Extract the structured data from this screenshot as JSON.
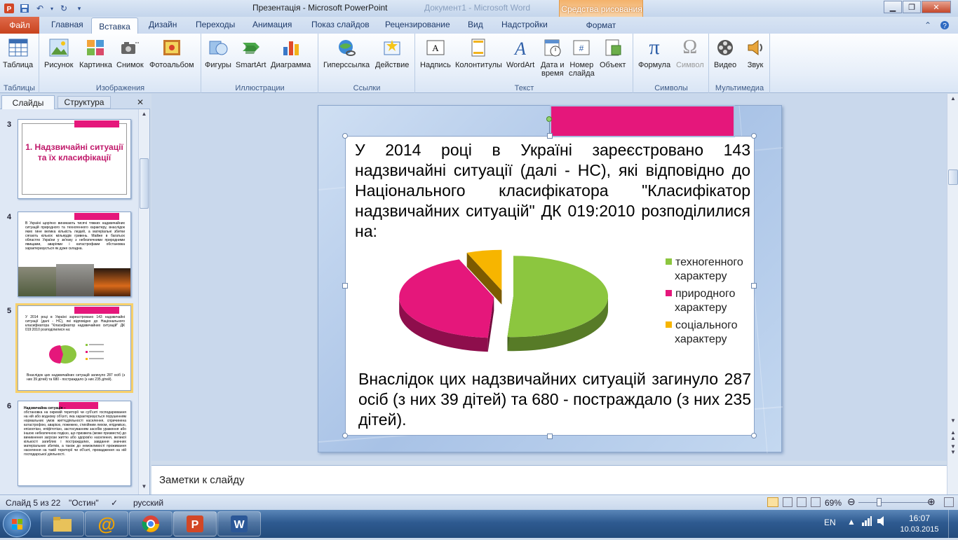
{
  "window": {
    "title": "Презентація - Microsoft PowerPoint",
    "background_window_title": "Документ1 - Microsoft Word",
    "context_tab_group": "Средства рисования"
  },
  "tabs": {
    "file": "Файл",
    "items": [
      "Главная",
      "Вставка",
      "Дизайн",
      "Переходы",
      "Анимация",
      "Показ слайдов",
      "Рецензирование",
      "Вид",
      "Надстройки"
    ],
    "active": "Вставка",
    "format": "Формат"
  },
  "ribbon": {
    "groups": [
      {
        "label": "Таблицы",
        "buttons": [
          {
            "label": "Таблица",
            "icon": "table-icon"
          }
        ]
      },
      {
        "label": "Изображения",
        "buttons": [
          {
            "label": "Рисунок",
            "icon": "picture-icon"
          },
          {
            "label": "Картинка",
            "icon": "clipart-icon"
          },
          {
            "label": "Снимок",
            "icon": "screenshot-icon"
          },
          {
            "label": "Фотоальбом",
            "icon": "photo-album-icon"
          }
        ]
      },
      {
        "label": "Иллюстрации",
        "buttons": [
          {
            "label": "Фигуры",
            "icon": "shapes-icon"
          },
          {
            "label": "SmartArt",
            "icon": "smartart-icon"
          },
          {
            "label": "Диаграмма",
            "icon": "chart-icon"
          }
        ]
      },
      {
        "label": "Ссылки",
        "buttons": [
          {
            "label": "Гиперссылка",
            "icon": "hyperlink-icon"
          },
          {
            "label": "Действие",
            "icon": "action-icon"
          }
        ]
      },
      {
        "label": "Текст",
        "buttons": [
          {
            "label": "Надпись",
            "icon": "textbox-icon"
          },
          {
            "label": "Колонтитулы",
            "icon": "header-footer-icon"
          },
          {
            "label": "WordArt",
            "icon": "wordart-icon"
          },
          {
            "label": "Дата и\nвремя",
            "icon": "date-time-icon"
          },
          {
            "label": "Номер\nслайда",
            "icon": "slide-number-icon"
          },
          {
            "label": "Объект",
            "icon": "object-icon"
          }
        ]
      },
      {
        "label": "Символы",
        "buttons": [
          {
            "label": "Формула",
            "icon": "equation-icon"
          },
          {
            "label": "Символ",
            "icon": "symbol-icon",
            "disabled": true
          }
        ]
      },
      {
        "label": "Мультимедиа",
        "buttons": [
          {
            "label": "Видео",
            "icon": "video-icon"
          },
          {
            "label": "Звук",
            "icon": "audio-icon"
          }
        ]
      }
    ]
  },
  "left_pane": {
    "tab_slides": "Слайды",
    "tab_outline": "Структура",
    "thumbnails": [
      {
        "number": "3",
        "text": "1. Надзвичайні ситуації та їх класифікації"
      },
      {
        "number": "4",
        "text": "В Україні щорічно виникають тисячі тяжких надзвичайних ситуацій природного та техногенного характеру, внаслідок яких гине велика кількість людей, а матеріальні збитки сягають кількох мільярдів гривень. Майже в багатьох областях України у зв'язку з небезпечними природними явищами, аваріями і катастрофами обстановка характеризується як дуже складна."
      },
      {
        "number": "5",
        "text": "У 2014 році в Україні зареєстровано 143 надзвичайні ситуації (далі - НС), які відповідно до Національного класифікатора \"Класифікатор надзвичайних ситуацій\" ДК 019:2010 розподілилися на:",
        "bottom": "Внаслідок цих надзвичайних ситуацій загинуло 287 осіб (з них 39 дітей) та 680 - постраждало (з них 235 дітей).",
        "selected": true
      },
      {
        "number": "6",
        "title": "Надзвичайна ситуація –",
        "text": "обстановка на окремій території чи суб'єкті господарювання на ній або водному об'єкті, яка характеризується порушенням нормальних умов життєдіяльності населення, спричинена катастрофою, аварією, пожежею, стихійним лихом, епідемією, епізоотією, епіфітотією, застосуванням засобів ураження або іншою небезпечною подією, що призвела (може призвести) до виникнення загрози життю або здоров'ю населення, великої кількості загиблих і постраждалих, завдання значних матеріальних збитків, а також до неможливості проживання населення на такій території чи об'єкті, провадження на ній господарської діяльності."
      }
    ]
  },
  "slide": {
    "main_text": "У 2014 році в Україні зареєстровано 143 надзвичайні ситуації (далі - НС), які відповідно до Національного класифікатора \"Класифікатор надзвичайних ситуацій\" ДК 019:2010 розподілилися на:",
    "bottom_text": "Внаслідок цих надзвичайних ситуацій загинуло 287 осіб (з них 39 дітей) та 680 - постраждало (з них 235 дітей)."
  },
  "chart_data": {
    "type": "pie",
    "title": "",
    "categories": [
      "техногенного характеру",
      "природного характеру",
      "соціального характеру"
    ],
    "values": [
      51,
      43,
      6
    ],
    "colors": [
      "#8cc63f",
      "#e5177b",
      "#f7b500"
    ],
    "legend_placement": "right",
    "exploded": true,
    "style": "3d"
  },
  "notes": {
    "placeholder": "Заметки к слайду"
  },
  "status": {
    "slide_info": "Слайд 5 из 22",
    "theme": "\"Остин\"",
    "language": "русский",
    "zoom": "69%"
  },
  "taskbar": {
    "language": "EN",
    "time": "16:07",
    "date": "10.03.2015"
  },
  "colors": {
    "accent_pink": "#e5177b",
    "ribbon_tab_file": "#d3532f",
    "context_tab": "#f4b26b"
  }
}
